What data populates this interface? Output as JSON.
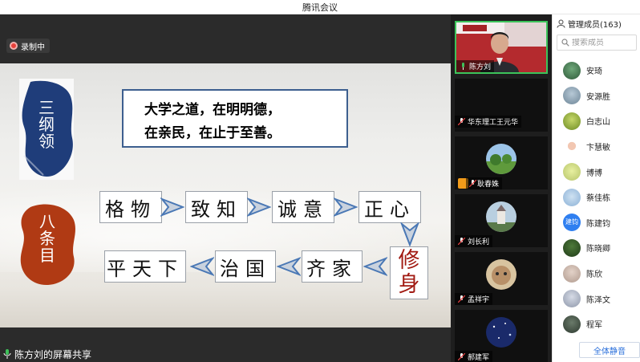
{
  "window": {
    "title": "腾讯会议"
  },
  "recording": {
    "label": "录制中"
  },
  "slide": {
    "stamp_top": "三\n纲\n领",
    "stamp_bottom": "八\n条\n目",
    "quote_line1": "大学之道，在明明德，",
    "quote_line2": "在亲民，在止于至善。",
    "steps_row1": [
      "格物",
      "致知",
      "诚意",
      "正心"
    ],
    "step_center": "修\n身",
    "steps_row2": [
      "齐家",
      "治国",
      "平天下"
    ],
    "colors": {
      "frame": "#3d5f8f",
      "stamp": "#1f3d7a",
      "stamp_red": "#b03a14",
      "xiushen": "#a11a12"
    }
  },
  "share_label": "陈方刘的屏幕共享",
  "video_tiles": [
    {
      "name": "陈方刘"
    },
    {
      "name": "华东理工王元华"
    },
    {
      "name": "耿春姝"
    },
    {
      "name": "刘长利"
    },
    {
      "name": "孟祥宇"
    },
    {
      "name": "郝建军"
    }
  ],
  "members_panel": {
    "title": "管理成员(163)",
    "search_placeholder": "搜索成员",
    "members": [
      {
        "name": "安琦"
      },
      {
        "name": "安源胜"
      },
      {
        "name": "白志山"
      },
      {
        "name": "卞慧敏"
      },
      {
        "name": "博博"
      },
      {
        "name": "蔡佳栋"
      },
      {
        "name": "陈建钧",
        "avatar_text": "建钧",
        "avatar_color": "#2f7ff0"
      },
      {
        "name": "陈晓卿"
      },
      {
        "name": "陈欣"
      },
      {
        "name": "陈泽文"
      },
      {
        "name": "程军"
      }
    ],
    "mute_all": "全体静音"
  }
}
